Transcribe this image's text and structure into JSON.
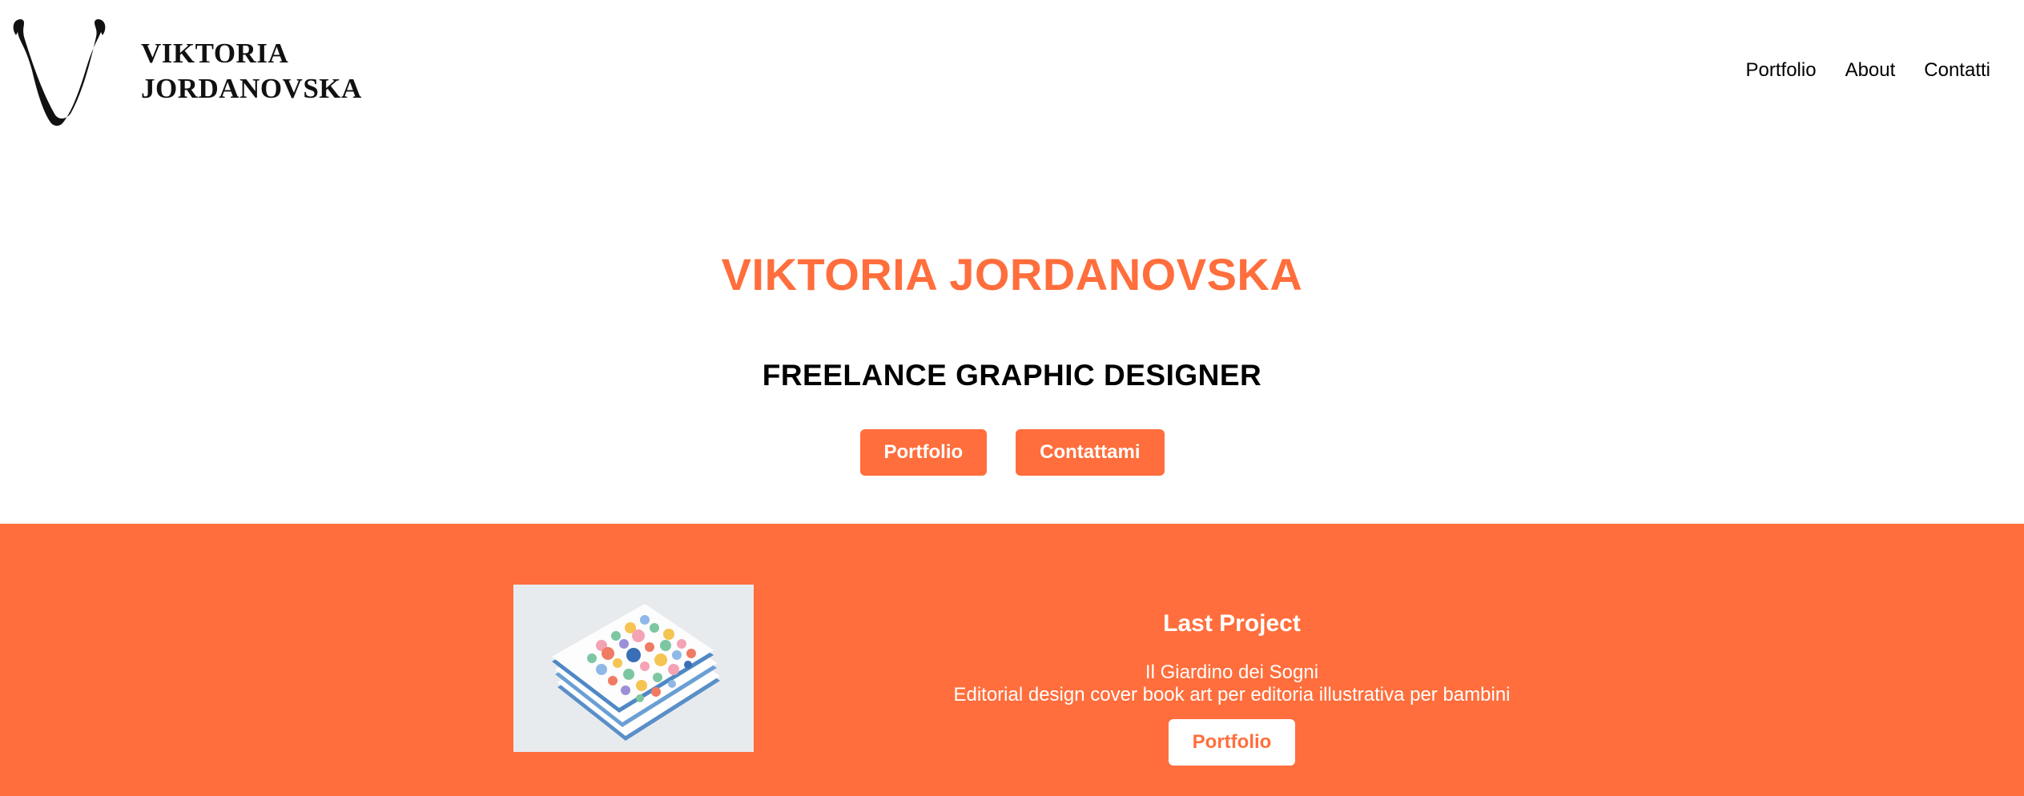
{
  "header": {
    "logo_line1": "VIKTORIA",
    "logo_line2": "JORDANOVSKA",
    "nav": [
      "Portfolio",
      "About",
      "Contatti"
    ]
  },
  "hero": {
    "title": "VIKTORIA JORDANOVSKA",
    "subtitle": "FREELANCE GRAPHIC DESIGNER",
    "buttons": [
      "Portfolio",
      "Contattami"
    ]
  },
  "last_project": {
    "heading": "Last Project",
    "name": "Il Giardino dei Sogni",
    "description": "Editorial design cover book art per editoria illustrativa per bambini",
    "button": "Portfolio"
  },
  "colors": {
    "accent": "#ff6e3c",
    "text": "#000000",
    "background": "#ffffff"
  }
}
